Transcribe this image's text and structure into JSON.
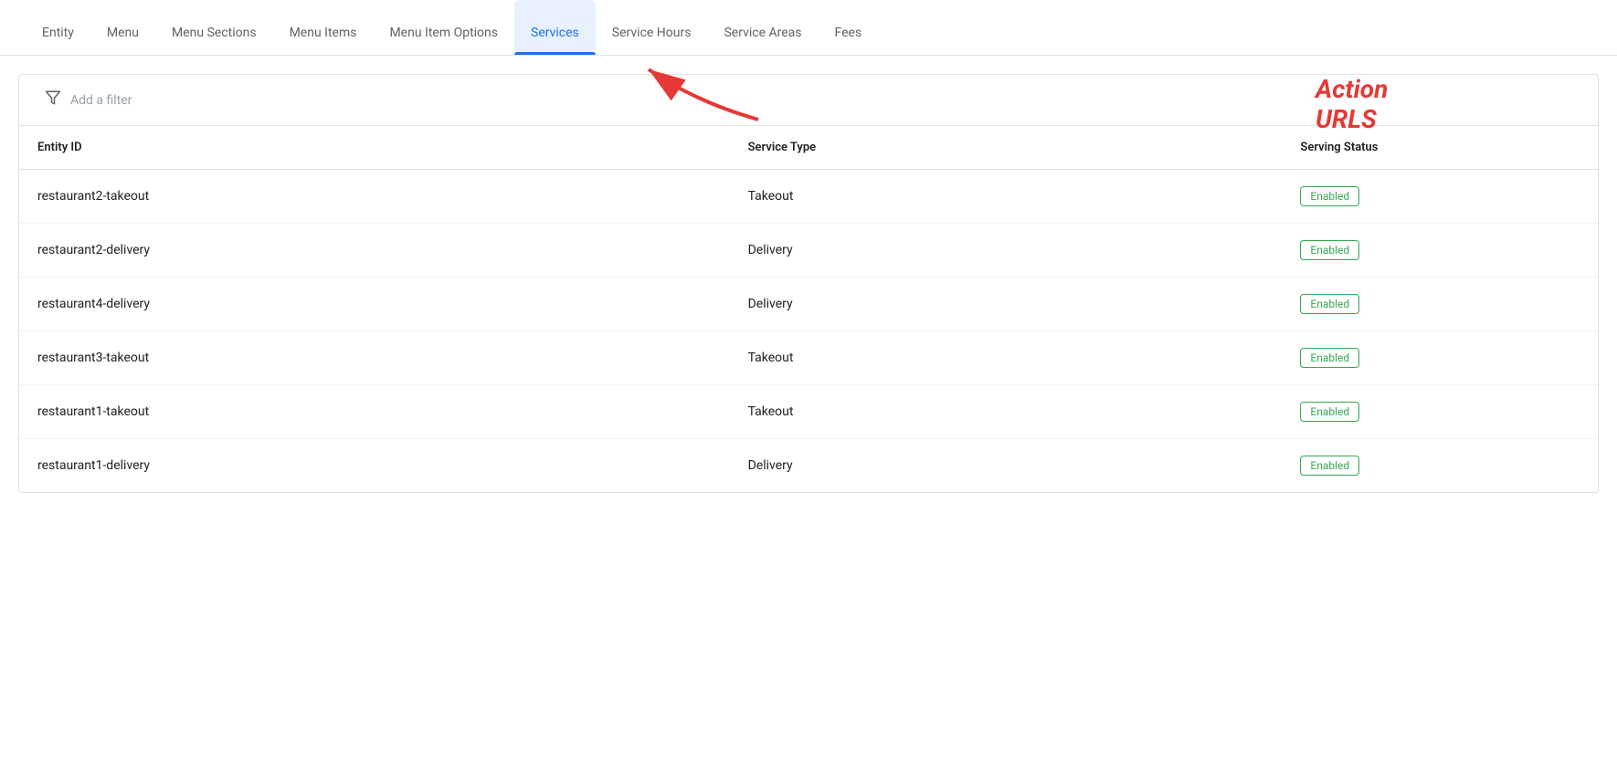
{
  "tabs": [
    {
      "id": "entity",
      "label": "Entity",
      "active": false
    },
    {
      "id": "menu",
      "label": "Menu",
      "active": false
    },
    {
      "id": "menu-sections",
      "label": "Menu Sections",
      "active": false
    },
    {
      "id": "menu-items",
      "label": "Menu Items",
      "active": false
    },
    {
      "id": "menu-item-options",
      "label": "Menu Item Options",
      "active": false
    },
    {
      "id": "services",
      "label": "Services",
      "active": true
    },
    {
      "id": "service-hours",
      "label": "Service Hours",
      "active": false
    },
    {
      "id": "service-areas",
      "label": "Service Areas",
      "active": false
    },
    {
      "id": "fees",
      "label": "Fees",
      "active": false
    }
  ],
  "filter": {
    "placeholder": "Add a filter"
  },
  "annotation": {
    "label": "Action URLS"
  },
  "table": {
    "columns": [
      {
        "id": "entity-id",
        "label": "Entity ID"
      },
      {
        "id": "service-type",
        "label": "Service Type"
      },
      {
        "id": "serving-status",
        "label": "Serving Status"
      }
    ],
    "rows": [
      {
        "entity_id": "restaurant2-takeout",
        "service_type": "Takeout",
        "serving_status": "Enabled"
      },
      {
        "entity_id": "restaurant2-delivery",
        "service_type": "Delivery",
        "serving_status": "Enabled"
      },
      {
        "entity_id": "restaurant4-delivery",
        "service_type": "Delivery",
        "serving_status": "Enabled"
      },
      {
        "entity_id": "restaurant3-takeout",
        "service_type": "Takeout",
        "serving_status": "Enabled"
      },
      {
        "entity_id": "restaurant1-takeout",
        "service_type": "Takeout",
        "serving_status": "Enabled"
      },
      {
        "entity_id": "restaurant1-delivery",
        "service_type": "Delivery",
        "serving_status": "Enabled"
      }
    ]
  }
}
